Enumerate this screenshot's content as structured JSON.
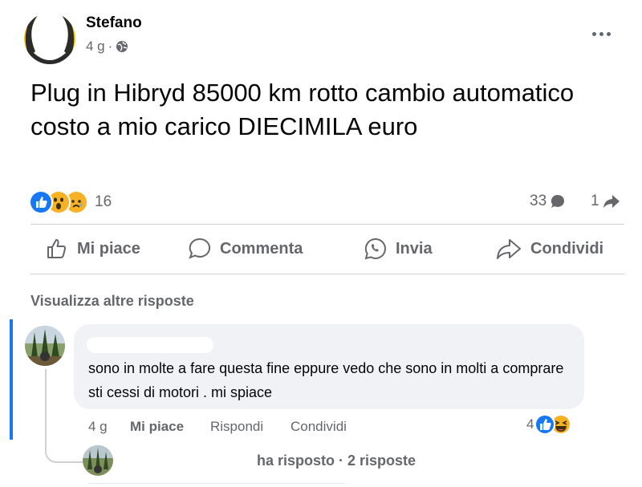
{
  "post": {
    "author": "Stefano",
    "time": "4 g",
    "separator": "·",
    "text": "Plug in Hibryd 85000 km rotto cambio automatico costo a mio carico DIECIMILA euro",
    "reactions": {
      "icons": [
        "like-icon",
        "wow-icon",
        "sad-icon"
      ],
      "count": "16"
    },
    "comments_count": "33",
    "shares_count": "1"
  },
  "actions": {
    "like": "Mi piace",
    "comment": "Commenta",
    "send": "Invia",
    "share": "Condividi"
  },
  "comments": {
    "view_more": "Visualizza altre risposte",
    "items": [
      {
        "text": "sono in molte a fare questa fine eppure vedo che sono in molti a comprare sti cessi di motori . mi spiace",
        "time": "4 g",
        "like": "Mi piace",
        "reply": "Rispondi",
        "share": "Condividi",
        "reaction_count": "4",
        "reaction_icons": [
          "like-icon",
          "haha-icon"
        ]
      }
    ],
    "replies_link": "ha risposto · 2 risposte"
  },
  "colors": {
    "like_blue": "#1877f2",
    "reaction_yellow": "#f7b125",
    "secondary_text": "#65676b",
    "bubble_bg": "#f0f2f5"
  }
}
